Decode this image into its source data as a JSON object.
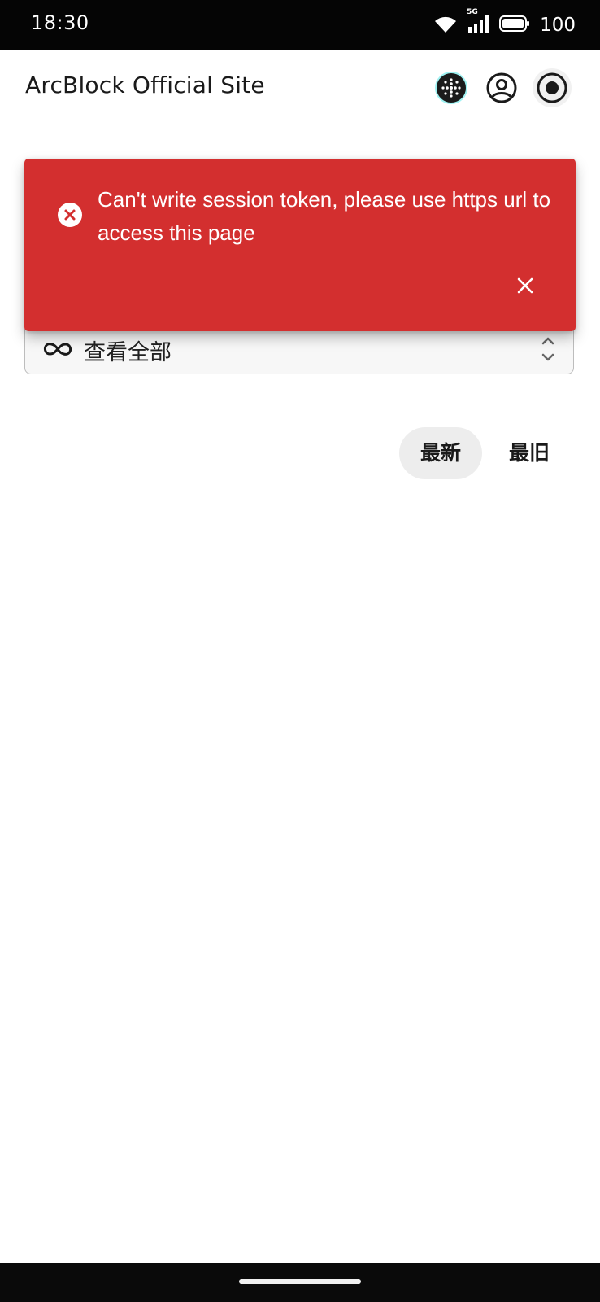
{
  "status_bar": {
    "time": "18:30",
    "network_label": "5G",
    "battery": "100"
  },
  "header": {
    "title": "ArcBlock Official Site",
    "icons": [
      "network-dots-icon",
      "user-circle-icon",
      "record-icon"
    ]
  },
  "filter": {
    "icon": "infinity-icon",
    "label": "查看全部"
  },
  "sort": {
    "newest_label": "最新",
    "oldest_label": "最旧",
    "selected": "newest"
  },
  "snackbar": {
    "message": "Can't write session token, please use https url to access this page",
    "color": "#d32f2f"
  }
}
